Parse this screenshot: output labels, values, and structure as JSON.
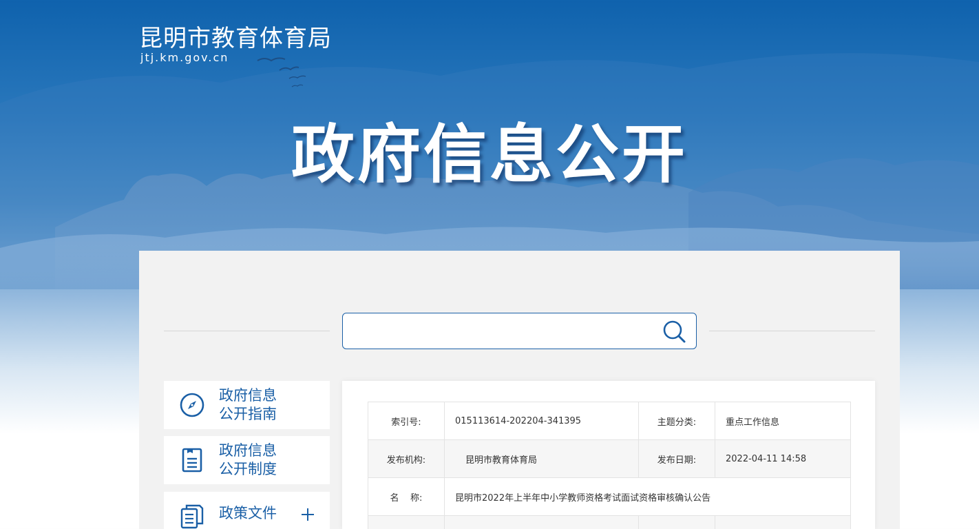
{
  "header": {
    "site_title": "昆明市教育体育局",
    "site_domain": "jtj.km.gov.cn",
    "hero_title": "政府信息公开"
  },
  "search": {
    "placeholder": "",
    "icon": "search-icon"
  },
  "sidebar": {
    "items": [
      {
        "label_line1": "政府信息",
        "label_line2": "公开指南",
        "icon": "compass-icon"
      },
      {
        "label_line1": "政府信息",
        "label_line2": "公开制度",
        "icon": "document-icon"
      },
      {
        "label_line1": "政策文件",
        "icon": "files-icon",
        "expand_icon": "plus-icon"
      }
    ]
  },
  "info_table": {
    "rows": [
      {
        "label1": "索引号:",
        "value1": "015113614-202204-341395",
        "label2": "主题分类:",
        "value2": "重点工作信息"
      },
      {
        "label1": "发布机构:",
        "value1": "昆明市教育体育局",
        "label2": "发布日期:",
        "value2": "2022-04-11 14:58"
      },
      {
        "label1": "名    称:",
        "value1": "昆明市2022年上半年中小学教师资格考试面试资格审核确认公告"
      }
    ]
  },
  "colors": {
    "brand_blue": "#1a5fa6",
    "banner_top": "#0f62ad",
    "panel_bg": "#f2f2f2"
  }
}
